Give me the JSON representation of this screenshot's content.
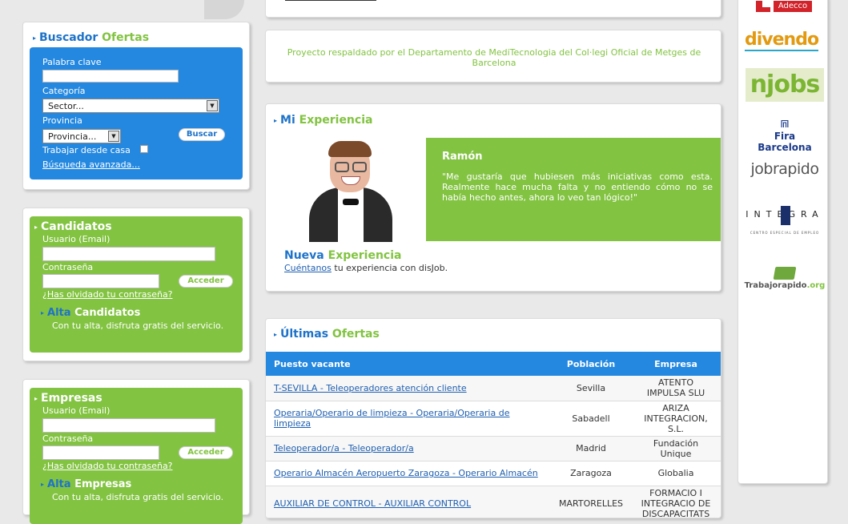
{
  "buscador": {
    "title_a": "Buscador",
    "title_b": "Ofertas",
    "keyword_label": "Palabra clave",
    "category_label": "Categoría",
    "category_value": "Sector...",
    "province_label": "Provincia",
    "province_value": "Provincia...",
    "search_button": "Buscar",
    "remote_label": "Trabajar desde casa",
    "advanced_link": "Búsqueda avanzada..."
  },
  "candidatos": {
    "title": "Candidatos",
    "user_label": "Usuario (Email)",
    "password_label": "Contraseña",
    "login_button": "Acceder",
    "forgot_link": "¿Has olvidado tu contraseña?",
    "signup_a": "Alta",
    "signup_b": "Candidatos",
    "signup_text": "Con tu alta, disfruta gratis del servicio."
  },
  "empresas": {
    "title": "Empresas",
    "user_label": "Usuario (Email)",
    "password_label": "Contraseña",
    "login_button": "Acceder",
    "forgot_link": "¿Has olvidado tu contraseña?",
    "signup_a": "Alta",
    "signup_b": "Empresas",
    "signup_text": "Con tu alta, disfruta gratis del servicio."
  },
  "proyecto": {
    "text": "Proyecto respaldado por el Departamento de MediTecnologia del Col·legi Oficial de Metges de Barcelona"
  },
  "experiencia": {
    "title_a": "Mi",
    "title_b": "Experiencia",
    "name": "Ramón",
    "quote": "\"Me gustaría que hubiesen más iniciativas como esta. Realmente hace mucha falta y no entiendo cómo no se había hecho antes, ahora lo veo tan lógico!\"",
    "new_a": "Nueva",
    "new_b": "Experiencia",
    "tell_link": "Cuéntanos",
    "tell_text": " tu experiencia con disJob."
  },
  "ultimas": {
    "title_a": "Últimas",
    "title_b": "Ofertas",
    "columns": [
      "Puesto vacante",
      "Población",
      "Empresa"
    ],
    "rows": [
      {
        "puesto": "T-SEVILLA - Teleoperadores atención cliente",
        "poblacion": "Sevilla",
        "empresa": "ATENTO IMPULSA SLU"
      },
      {
        "puesto": "Operaria/Operario de limpieza - Operaria/Operaria de limpieza",
        "poblacion": "Sabadell",
        "empresa": "ARIZA INTEGRACION, S.L."
      },
      {
        "puesto": "Teleoperador/a - Teleoperador/a",
        "poblacion": "Madrid",
        "empresa": "Fundación Unique"
      },
      {
        "puesto": "Operario Almacén Aeropuerto Zaragoza - Operario Almacén",
        "poblacion": "Zaragoza",
        "empresa": "Globalia"
      },
      {
        "puesto": "AUXILIAR DE CONTROL - AUXILIAR CONTROL",
        "poblacion": "MARTORELLES",
        "empresa": "FORMACIO I INTEGRACIO DE DISCAPACITATS"
      }
    ]
  },
  "sponsors": {
    "adecco": "Adecco",
    "divendo": "divendo",
    "njobs": "njobs",
    "fira": "Fira Barcelona",
    "jobrapido": "jobrapido",
    "integra": "INTEGRA",
    "integra_sub": "CENTRO ESPECIAL DE EMPLEO",
    "trabajo_a": "Trabajorapido",
    "trabajo_b": ".org"
  },
  "colors": {
    "blue": "#2488e0",
    "green": "#82c341",
    "link": "#1e5fb0"
  }
}
